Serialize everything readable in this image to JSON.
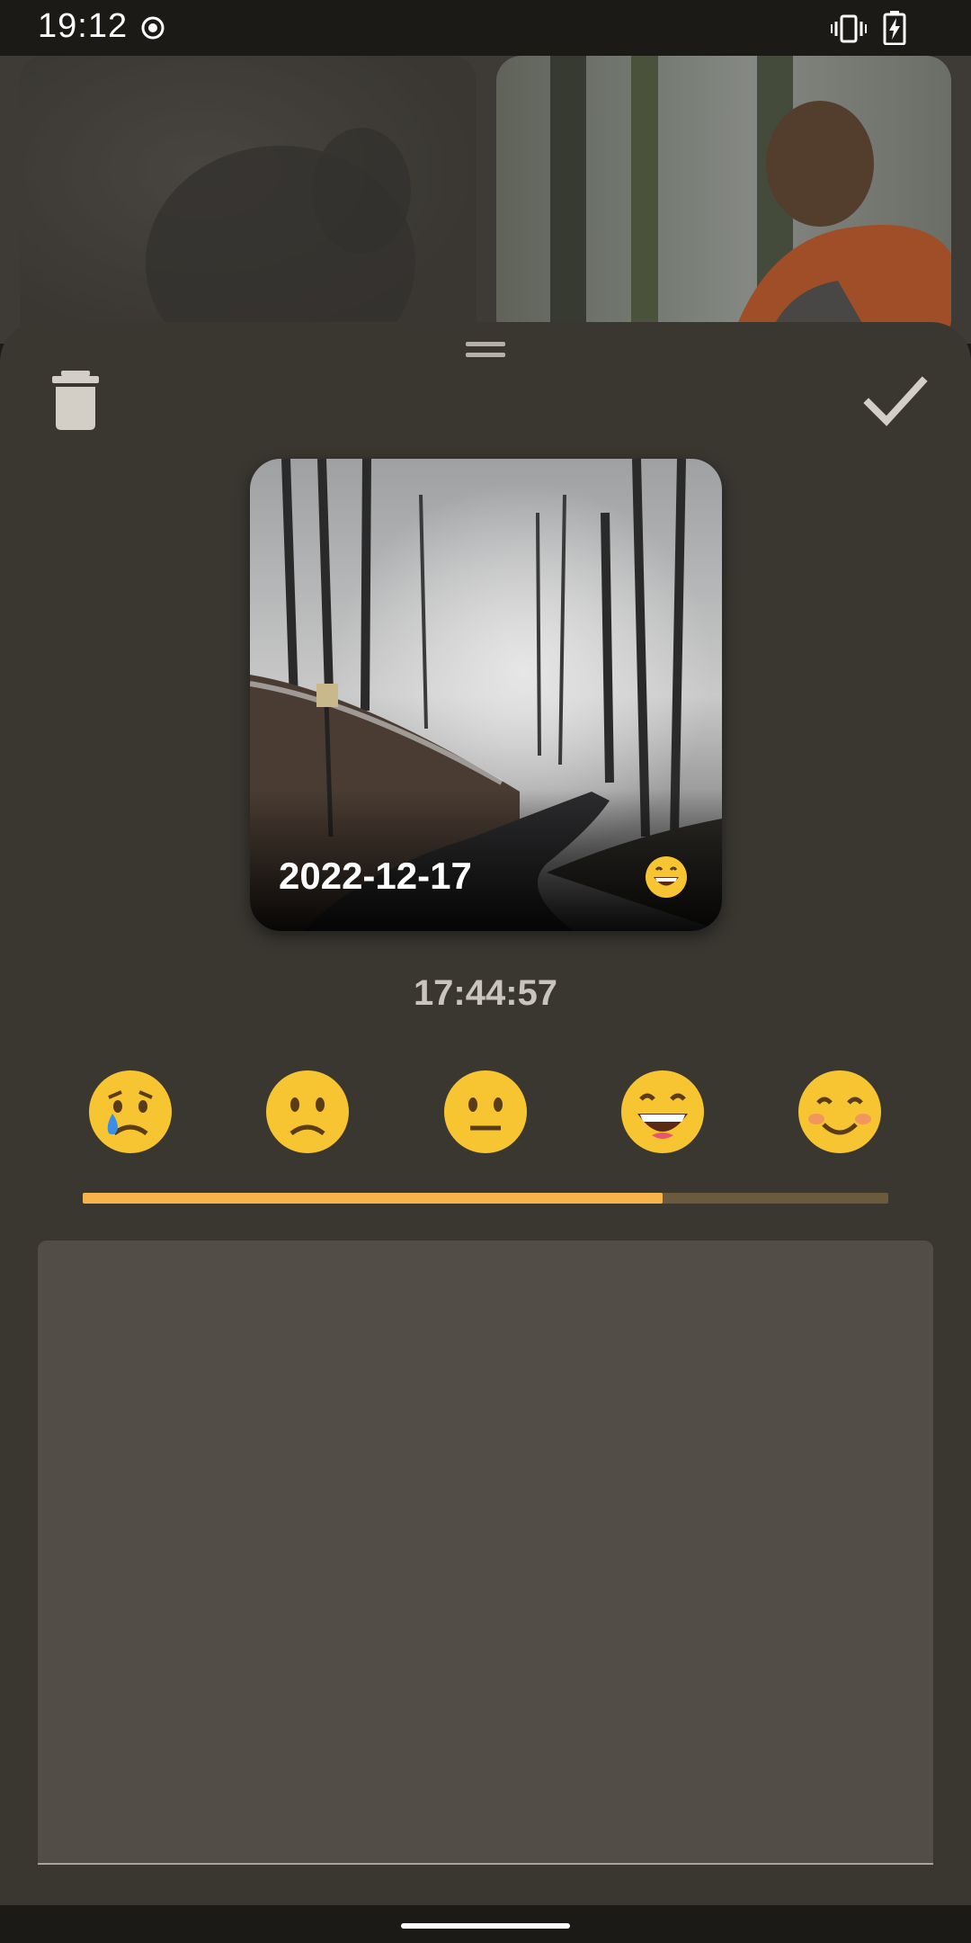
{
  "status_bar": {
    "time": "19:12",
    "icons": [
      "screen-record-icon",
      "vibrate-icon",
      "battery-charging-icon"
    ]
  },
  "background": {
    "tiles": [
      "dim-photo-tile",
      "person-at-window-photo-tile"
    ]
  },
  "sheet": {
    "delete_icon": "trash-icon",
    "confirm_icon": "checkmark-icon"
  },
  "entry": {
    "photo": "snowy-forest-road-photo",
    "date": "2022-12-17",
    "mood_icon": "grinning-face-icon",
    "time": "17:44:57"
  },
  "moods": [
    {
      "name": "crying-face-icon"
    },
    {
      "name": "slightly-frowning-face-icon"
    },
    {
      "name": "neutral-face-icon"
    },
    {
      "name": "grinning-face-icon"
    },
    {
      "name": "smiling-face-icon"
    }
  ],
  "mood_slider": {
    "value": 0.72
  },
  "note": {
    "value": "",
    "placeholder": ""
  },
  "colors": {
    "accent": "#f7b44c",
    "track": "#6b5a3d",
    "sheet_bg": "#3a3731",
    "field_bg": "#524d47"
  }
}
